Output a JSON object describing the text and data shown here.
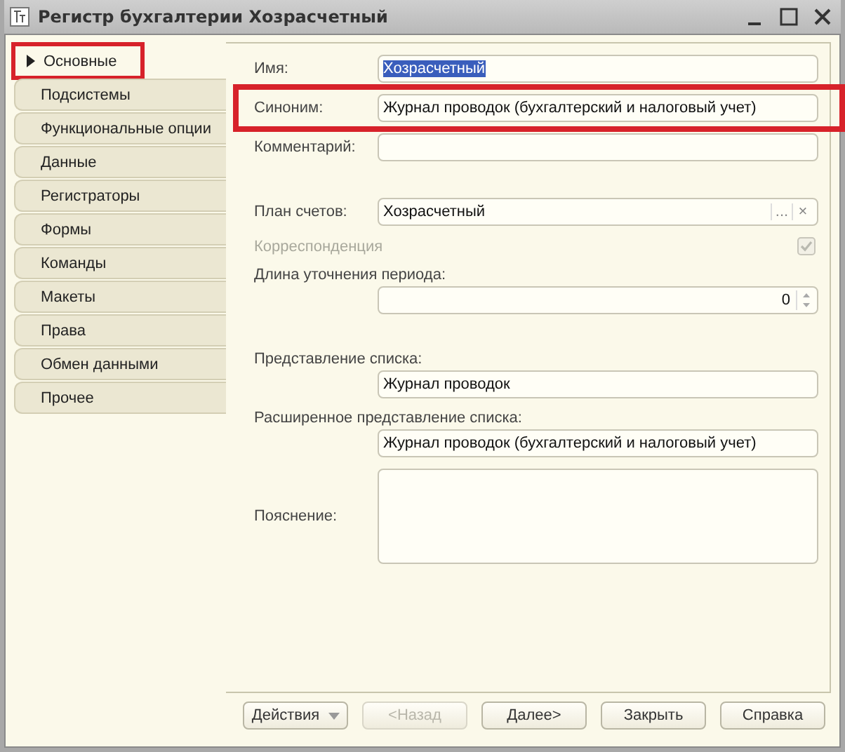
{
  "window": {
    "title": "Регистр бухгалтерии Хозрасчетный"
  },
  "tabs": [
    {
      "label": "Основные",
      "selected": true,
      "highlighted": true
    },
    {
      "label": "Подсистемы",
      "selected": false,
      "highlighted": false
    },
    {
      "label": "Функциональные опции",
      "selected": false,
      "highlighted": false
    },
    {
      "label": "Данные",
      "selected": false,
      "highlighted": false
    },
    {
      "label": "Регистраторы",
      "selected": false,
      "highlighted": false
    },
    {
      "label": "Формы",
      "selected": false,
      "highlighted": false
    },
    {
      "label": "Команды",
      "selected": false,
      "highlighted": false
    },
    {
      "label": "Макеты",
      "selected": false,
      "highlighted": false
    },
    {
      "label": "Права",
      "selected": false,
      "highlighted": false
    },
    {
      "label": "Обмен данными",
      "selected": false,
      "highlighted": false
    },
    {
      "label": "Прочее",
      "selected": false,
      "highlighted": false
    }
  ],
  "sections": [
    {
      "fields": [
        {
          "kind": "text",
          "label": "Имя:",
          "value": "Хозрасчетный",
          "text_selected": true,
          "highlighted": false
        },
        {
          "kind": "text",
          "label": "Синоним:",
          "value": "Журнал проводок (бухгалтерский и налоговый учет)",
          "highlighted": true
        },
        {
          "kind": "text",
          "label": "Комментарий:",
          "highlighted": false
        }
      ]
    },
    {
      "fields": [
        {
          "kind": "choice",
          "label": "План счетов:",
          "value": "Хозрасчетный",
          "choose_button": "...",
          "clear_button": "×"
        },
        {
          "kind": "checkbox",
          "label": "Корреспонденция",
          "checked": true,
          "disabled": true
        },
        {
          "kind": "number",
          "label": "Длина уточнения периода:",
          "value": "0"
        }
      ]
    },
    {
      "fields": [
        {
          "kind": "stacked",
          "label": "Представление списка:",
          "value": "Журнал проводок"
        },
        {
          "kind": "stacked",
          "label": "Расширенное представление списка:",
          "value": "Журнал проводок (бухгалтерский и налоговый учет)"
        },
        {
          "kind": "memo",
          "label": "Пояснение:"
        }
      ]
    }
  ],
  "buttons": [
    {
      "label": "Действия",
      "kind": "menu",
      "disabled": false
    },
    {
      "label": "<Назад",
      "kind": "plain",
      "disabled": true
    },
    {
      "label": "Далее>",
      "kind": "plain",
      "disabled": false
    },
    {
      "label": "Закрыть",
      "kind": "plain",
      "disabled": false
    },
    {
      "label": "Справка",
      "kind": "plain",
      "disabled": false
    }
  ]
}
